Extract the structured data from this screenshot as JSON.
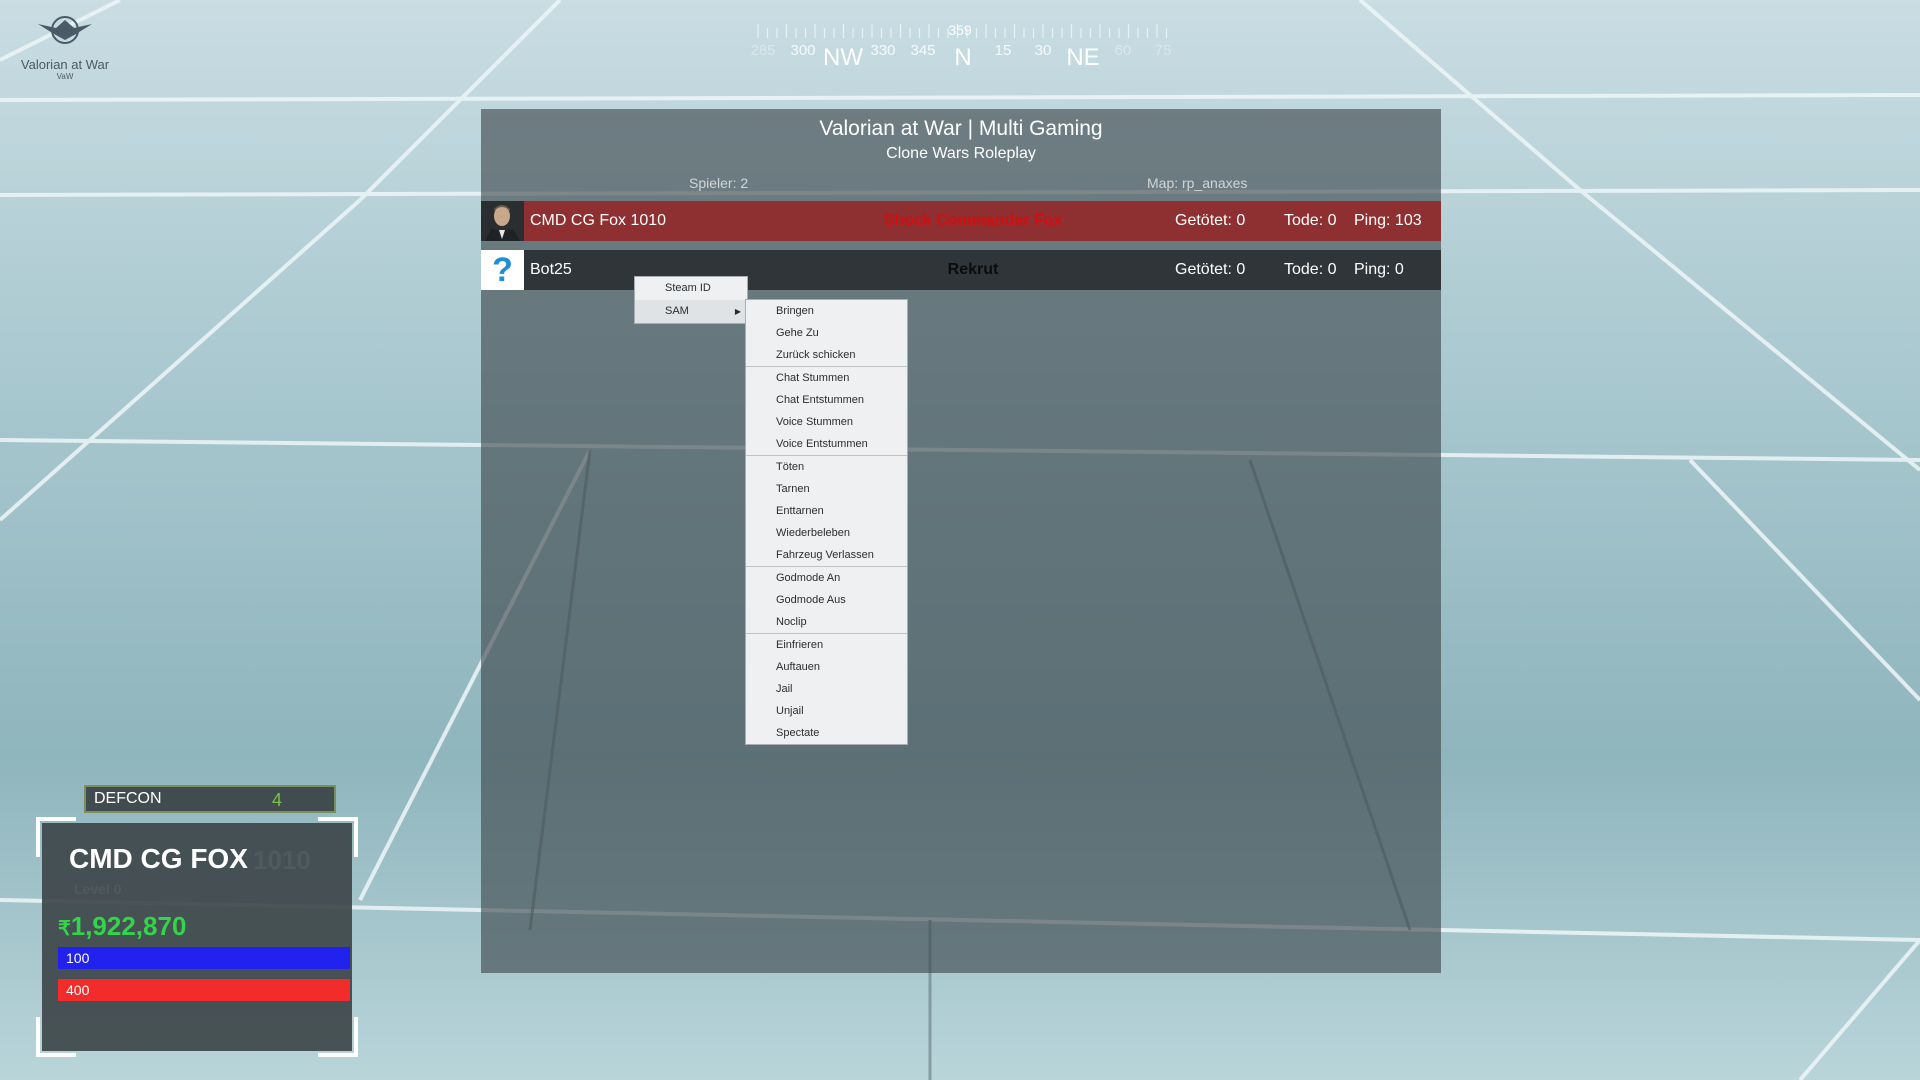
{
  "logo": {
    "name": "Valorian at War",
    "sub": "VaW"
  },
  "compass": {
    "heading": "359",
    "labels": [
      {
        "text": "285",
        "dim": true
      },
      {
        "text": "300"
      },
      {
        "text": "NW",
        "big": true
      },
      {
        "text": "330"
      },
      {
        "text": "345"
      },
      {
        "text": "N",
        "big": true
      },
      {
        "text": "15"
      },
      {
        "text": "30"
      },
      {
        "text": "NE",
        "big": true
      },
      {
        "text": "60",
        "dim": true
      },
      {
        "text": "75",
        "dim": true
      }
    ]
  },
  "scoreboard": {
    "title": "Valorian at War | Multi Gaming",
    "subtitle": "Clone Wars Roleplay",
    "players": "Spieler: 2",
    "map": "Map: rp_anaxes",
    "rows": [
      {
        "name": "CMD CG Fox 1010",
        "rank": "Shock Commander Fox",
        "kills": "Getötet: 0",
        "deaths": "Tode: 0",
        "ping": "Ping: 103"
      },
      {
        "name": "Bot25",
        "rank": "Rekrut",
        "kills": "Getötet: 0",
        "deaths": "Tode: 0",
        "ping": "Ping: 0",
        "avatar_glyph": "?"
      }
    ]
  },
  "context_menu": {
    "items": [
      "Steam ID",
      "SAM"
    ]
  },
  "sam_menu": {
    "groups": [
      [
        "Bringen",
        "Gehe Zu",
        "Zurück schicken"
      ],
      [
        "Chat Stummen",
        "Chat Entstummen",
        "Voice Stummen",
        "Voice Entstummen"
      ],
      [
        "Töten",
        "Tarnen",
        "Enttarnen",
        "Wiederbeleben",
        "Fahrzeug Verlassen"
      ],
      [
        "Godmode An",
        "Godmode Aus",
        "Noclip"
      ],
      [
        "Einfrieren",
        "Auftauen",
        "Jail",
        "Unjail",
        "Spectate"
      ]
    ]
  },
  "hud": {
    "defcon_label": "DEFCON",
    "defcon_value": "4",
    "player_name": "CMD CG FOX",
    "player_number": "1010",
    "level": "Level 0",
    "money": "1,922,870",
    "armor": "100",
    "health": "400",
    "colors": {
      "money": "#33d44a",
      "armor": "#2222f0",
      "health": "#f22b2b",
      "defcon": "#7ac143"
    }
  }
}
